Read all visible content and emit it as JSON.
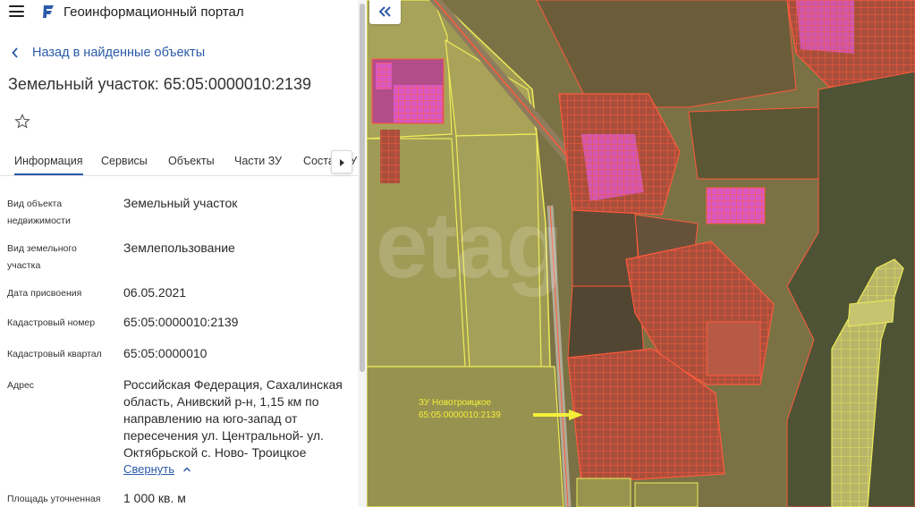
{
  "app": {
    "title": "Геоинформационный портал"
  },
  "nav": {
    "back_label": "Назад в найденные объекты"
  },
  "object": {
    "title": "Земельный участок: 65:05:0000010:2139"
  },
  "tabs": [
    "Информация",
    "Сервисы",
    "Объекты",
    "Части ЗУ",
    "Состав ЗУ"
  ],
  "fields": {
    "object_type": {
      "label": "Вид объекта недвижимости",
      "value": "Земельный участок"
    },
    "land_type": {
      "label": "Вид земельного участка",
      "value": "Землепользование"
    },
    "date": {
      "label": "Дата присвоения",
      "value": "06.05.2021"
    },
    "cadastral_number": {
      "label": "Кадастровый номер",
      "value": "65:05:0000010:2139"
    },
    "cadastral_quarter": {
      "label": "Кадастровый квартал",
      "value": "65:05:0000010"
    },
    "address": {
      "label": "Адрес",
      "value": "Российская Федерация, Сахалинская область, Анивский р-н, 1,15 км по направлению на юго-запад от пересечения ул. Центральной- ул. Октябрьской с. Ново- Троицкое"
    },
    "area": {
      "label": "Площадь уточненная",
      "value": "1 000 кв. м"
    }
  },
  "collapse_label": "Свернуть",
  "map": {
    "label_line1": "ЗУ Новотроицкое",
    "label_line2": "65:05:0000010:2139",
    "watermark": "etag"
  },
  "colors": {
    "accent": "#2b5ba8",
    "parcel_outline": "#ff5a3c",
    "parcel_fill": "#e85cc8",
    "field_outline": "#f0ec5a",
    "label": "#f4ef3a"
  },
  "icons": {
    "menu": "hamburger-icon",
    "logo": "portal-logo-icon",
    "back": "chevron-left-icon",
    "favorite": "star-outline-icon",
    "tabs_next": "triangle-right-icon",
    "collapse": "chevron-up-icon",
    "panel_toggle": "double-chevron-left-icon",
    "pointer": "arrow-right-icon"
  }
}
